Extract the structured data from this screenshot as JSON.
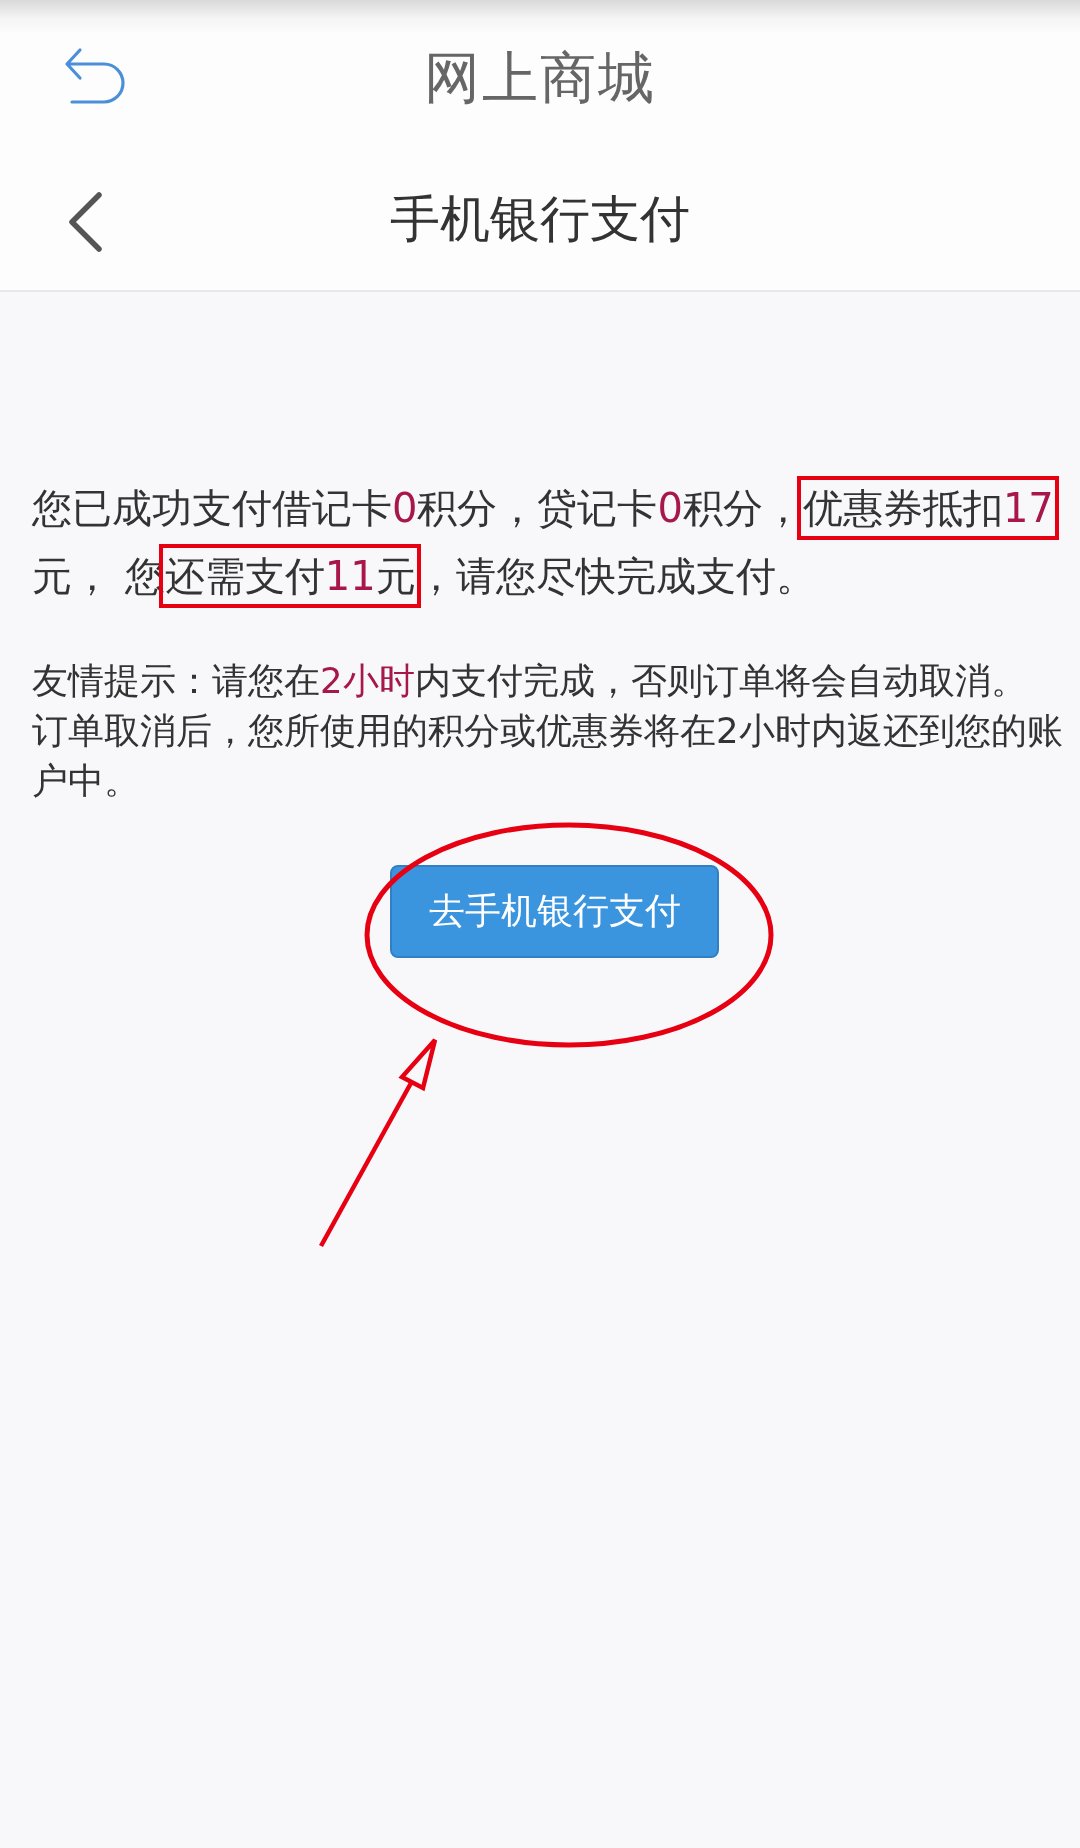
{
  "top_bar": {
    "title": "网上商城"
  },
  "page_header": {
    "title": "手机银行支付"
  },
  "payment_summary": [
    {
      "text": "您已成功支付借记卡",
      "highlight": false,
      "boxed": false
    },
    {
      "text": "0",
      "highlight": true,
      "boxed": false
    },
    {
      "text": "积分，贷记卡",
      "highlight": false,
      "boxed": false
    },
    {
      "text": "0",
      "highlight": true,
      "boxed": false
    },
    {
      "text": "积分，",
      "highlight": false,
      "boxed": false
    },
    {
      "text": "优惠券抵扣",
      "highlight": false,
      "boxed": true
    },
    {
      "text": "17",
      "highlight": true,
      "boxed": true
    },
    {
      "text": "元， 您",
      "highlight": false,
      "boxed": false
    },
    {
      "text": "还需支付",
      "highlight": false,
      "boxed": true
    },
    {
      "text": "11",
      "highlight": true,
      "boxed": true
    },
    {
      "text": "元",
      "highlight": false,
      "boxed": true
    },
    {
      "text": "，请您尽快完成支付。",
      "highlight": false,
      "boxed": false
    }
  ],
  "tips": [
    {
      "parts": [
        {
          "text": "友情提示：请您在",
          "highlight": false
        },
        {
          "text": "2小时",
          "highlight": true
        },
        {
          "text": "内支付完成，否则订单将会自动取消。",
          "highlight": false
        }
      ]
    },
    {
      "parts": [
        {
          "text": "订单取消后，您所使用的积分或优惠券将在2小时内返还到您的账户中。",
          "highlight": false
        }
      ]
    }
  ],
  "pay_button": {
    "label": "去手机银行支付"
  }
}
